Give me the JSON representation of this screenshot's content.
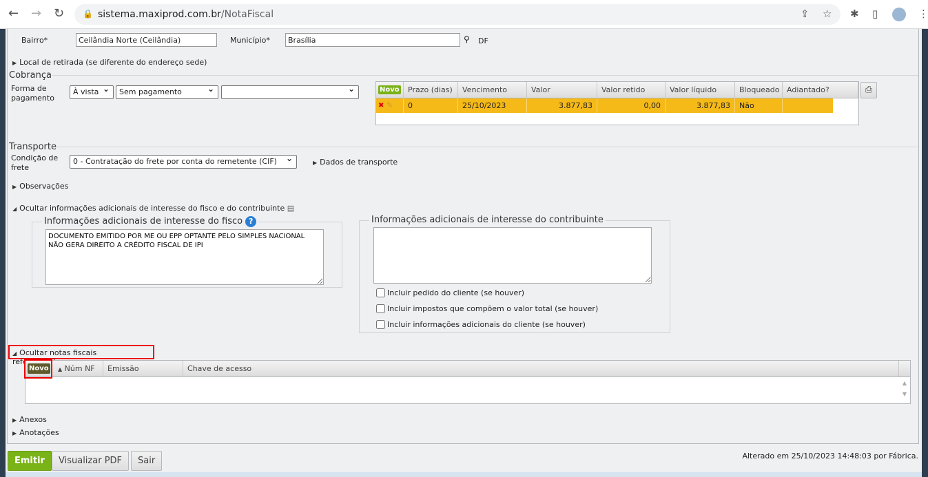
{
  "browser": {
    "url_host": "sistema.maxiprod.com.br",
    "url_path": "/NotaFiscal"
  },
  "address": {
    "bairro_label": "Bairro*",
    "bairro_value": "Ceilândia Norte (Ceilândia)",
    "municipio_label": "Município*",
    "municipio_value": "Brasília",
    "uf": "DF"
  },
  "local_retirada": "Local de retirada (se diferente do endereço sede)",
  "cobranca": {
    "title": "Cobrança",
    "forma_label": "Forma de pagamento",
    "forma_value": "À vista",
    "meio_value": "Sem pagamento",
    "extra_value": "",
    "grid": {
      "novo": "Novo",
      "columns": [
        "Prazo (dias)",
        "Vencimento",
        "Valor",
        "Valor retido",
        "Valor líquido",
        "Bloqueado",
        "Adiantado?"
      ],
      "rows": [
        {
          "prazo": "0",
          "vencimento": "25/10/2023",
          "valor": "3.877,83",
          "retido": "0,00",
          "liquido": "3.877,83",
          "bloqueado": "Não",
          "adiantado": ""
        }
      ]
    }
  },
  "transporte": {
    "title": "Transporte",
    "condicao_label": "Condição de frete",
    "condicao_value": "0 - Contratação do frete por conta do remetente (CIF)",
    "dados_link": "Dados de transporte"
  },
  "observacoes": "Observações",
  "info": {
    "toggle": "Ocultar informações adicionais de interesse do fisco e do contribuinte",
    "fisco_title": "Informações adicionais de interesse do fisco",
    "fisco_text": "DOCUMENTO EMITIDO POR ME OU EPP OPTANTE PELO SIMPLES NACIONAL NÃO GERA DIREITO A CRÉDITO FISCAL DE IPI",
    "contrib_title": "Informações adicionais de interesse do contribuinte",
    "contrib_text": "",
    "checks": [
      "Incluir pedido do cliente (se houver)",
      "Incluir impostos que compõem o valor total (se houver)",
      "Incluir informações adicionais do cliente (se houver)"
    ]
  },
  "referenciadas": {
    "toggle": "Ocultar notas fiscais referenciadas",
    "novo": "Novo",
    "columns": [
      "Núm NF",
      "Emissão",
      "Chave de acesso"
    ]
  },
  "anexos": "Anexos",
  "anotacoes": "Anotações",
  "footer": {
    "emitir": "Emitir",
    "pdf": "Visualizar PDF",
    "sair": "Sair",
    "status": "Alterado em 25/10/2023 14:48:03 por Fábrica."
  }
}
